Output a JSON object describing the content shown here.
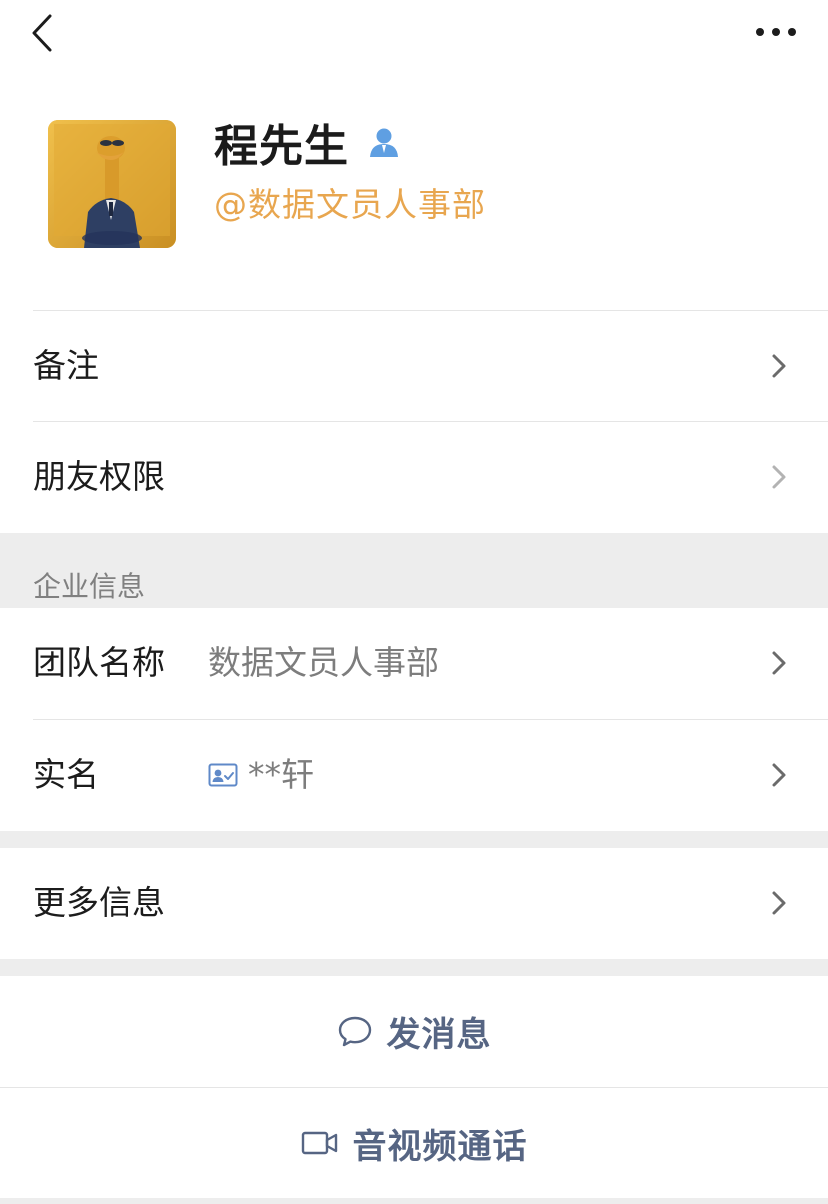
{
  "topbar": {
    "back_icon": "chevron-left-icon",
    "more_icon": "more-dots-icon"
  },
  "profile": {
    "name": "程先生",
    "org": "@数据文员人事部",
    "verified_icon": "person-badge-icon",
    "org_color": "#e8a64f"
  },
  "rows": {
    "remark": {
      "label": "备注"
    },
    "friend_permission": {
      "label": "朋友权限"
    }
  },
  "enterprise": {
    "section_title": "企业信息",
    "team_name": {
      "label": "团队名称",
      "value": "数据文员人事部"
    },
    "real_name": {
      "label": "实名",
      "value": "**轩",
      "icon": "id-card-icon"
    }
  },
  "more_info": {
    "label": "更多信息"
  },
  "actions": {
    "send_message": {
      "label": "发消息",
      "icon": "chat-bubble-icon"
    },
    "av_call": {
      "label": "音视频通话",
      "icon": "video-camera-icon"
    }
  },
  "colors": {
    "accent_text": "#566583",
    "background_gray": "#ededed"
  }
}
